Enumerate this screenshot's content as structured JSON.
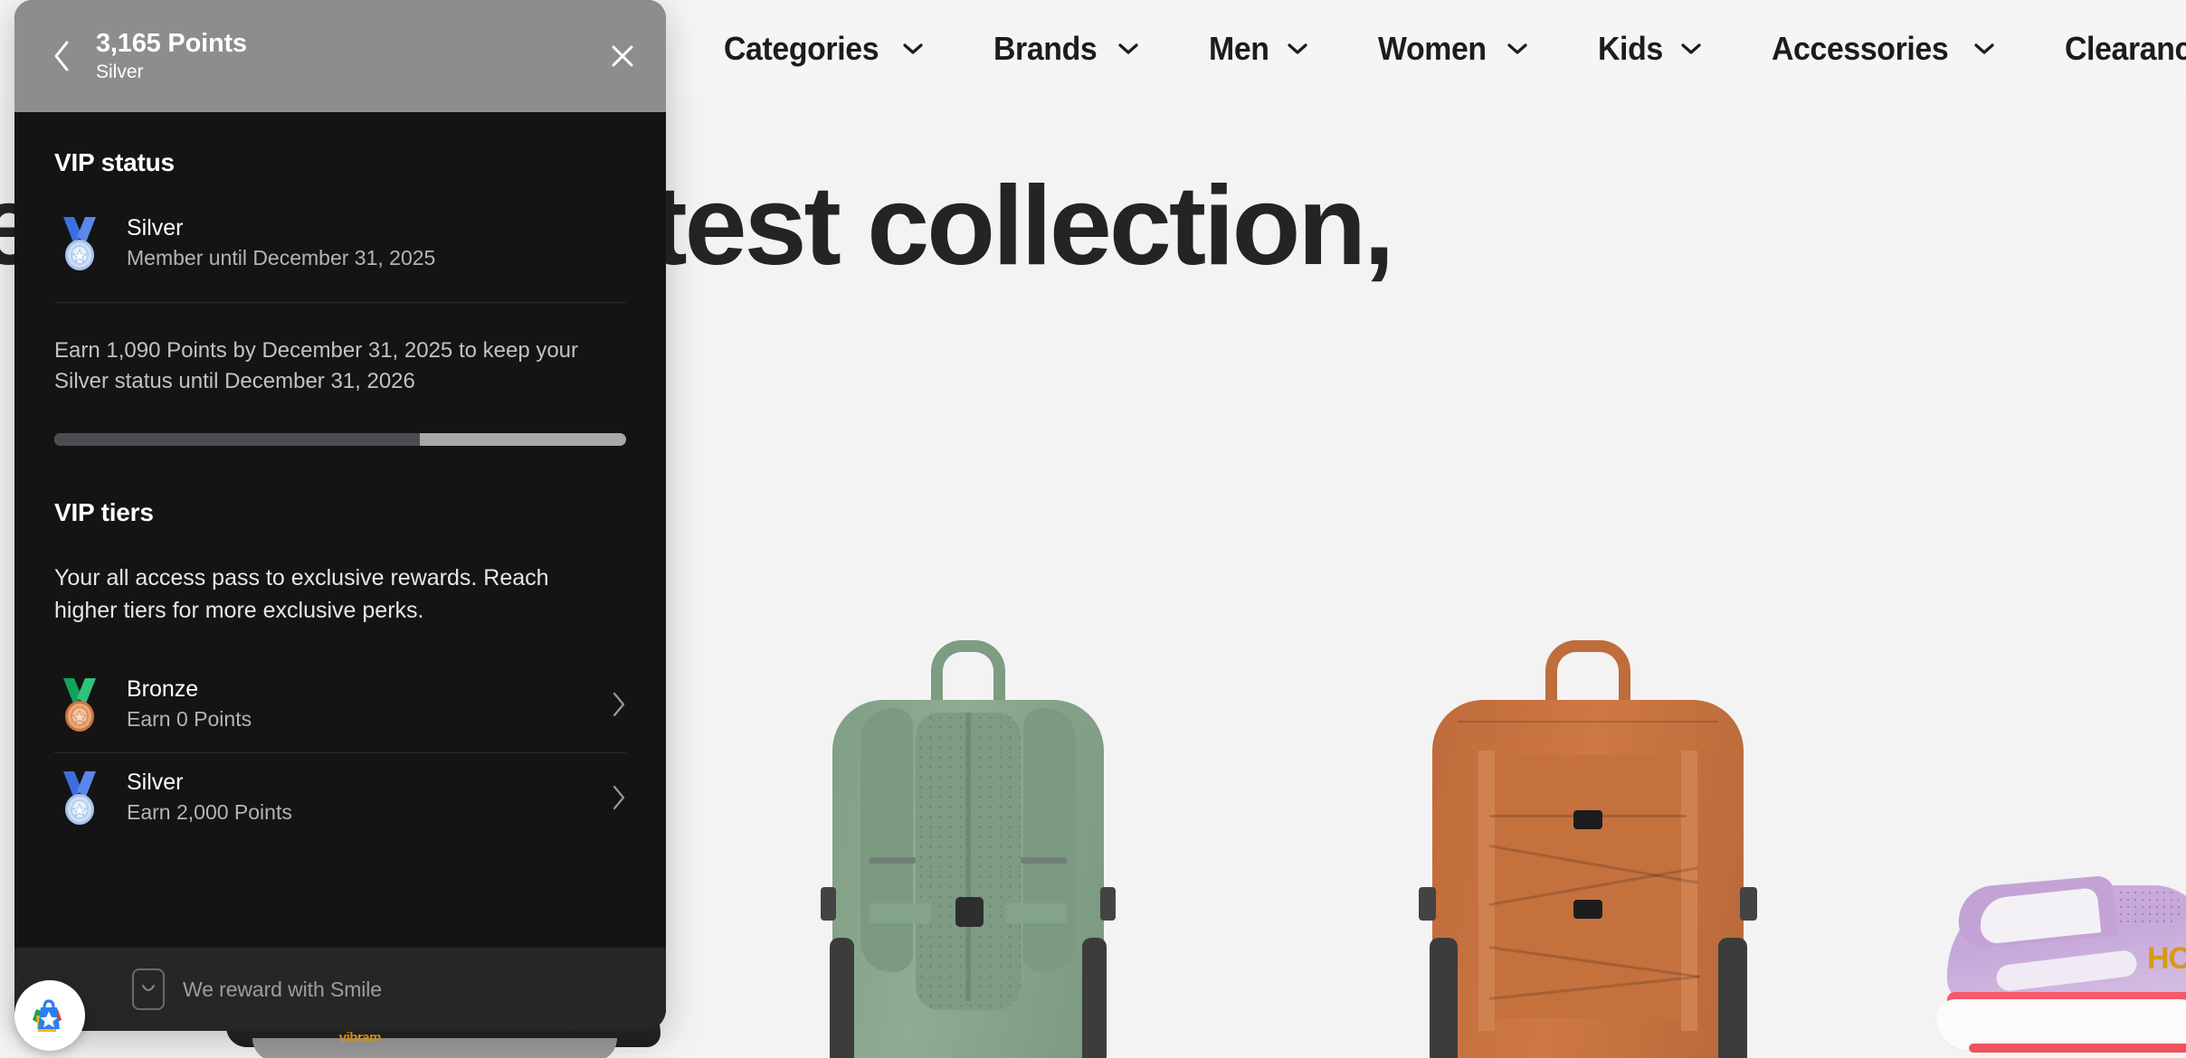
{
  "store": {
    "nav": {
      "items": [
        {
          "label": "Categories",
          "icon": "chevron-down-icon"
        },
        {
          "label": "Brands",
          "icon": "chevron-down-icon"
        },
        {
          "label": "Men",
          "icon": "chevron-down-icon"
        },
        {
          "label": "Women",
          "icon": "chevron-down-icon"
        },
        {
          "label": "Kids",
          "icon": "chevron-down-icon"
        },
        {
          "label": "Accessories",
          "icon": "chevron-down-icon"
        },
        {
          "label": "Clearance",
          "icon": "chevron-down-icon"
        }
      ]
    },
    "hero": {
      "headline": "New arrival, Latest collection,"
    },
    "products": [
      {
        "name": "green-backpack",
        "color": "#85a588"
      },
      {
        "name": "orange-backpack",
        "color": "#c9713f"
      },
      {
        "name": "lavender-running-shoe",
        "color": "#c9abd9",
        "logo": "HO"
      },
      {
        "name": "black-hiking-shoe",
        "brand": "vibram"
      }
    ]
  },
  "panel": {
    "header": {
      "back_icon": "chevron-left-icon",
      "points": "3,165 Points",
      "tier": "Silver",
      "close_icon": "close-icon"
    },
    "vip_status": {
      "title": "VIP status",
      "current": {
        "icon": "silver-medal-icon",
        "name": "Silver",
        "sub": "Member until December 31, 2025"
      },
      "earn_text": "Earn 1,090 Points by December 31, 2025 to keep your Silver status until December 31, 2026",
      "progress_percent": 64
    },
    "vip_tiers": {
      "title": "VIP tiers",
      "description": "Your all access pass to exclusive rewards. Reach higher tiers for more exclusive perks.",
      "items": [
        {
          "icon": "bronze-medal-icon",
          "name": "Bronze",
          "sub": "Earn 0 Points",
          "chevron": "chevron-right-icon"
        },
        {
          "icon": "silver-medal-icon",
          "name": "Silver",
          "sub": "Earn 2,000 Points",
          "chevron": "chevron-right-icon"
        }
      ]
    },
    "footer": {
      "badge_icon": "smile-badge-icon",
      "text": "We reward with Smile"
    }
  },
  "launcher": {
    "icon": "smile-shopping-bag-icon",
    "label": "Smile rewards launcher"
  },
  "colors": {
    "panel_bg": "#141414",
    "panel_header_bg": "#8d8d8d",
    "footer_bg": "#262626",
    "progress_fill": "#4c4c52",
    "progress_track": "#a8a8a8",
    "divider": "#2b2b2b",
    "page_bg": "#f3f3f3",
    "text_primary": "#ffffff",
    "text_secondary": "#b4b4b4"
  }
}
